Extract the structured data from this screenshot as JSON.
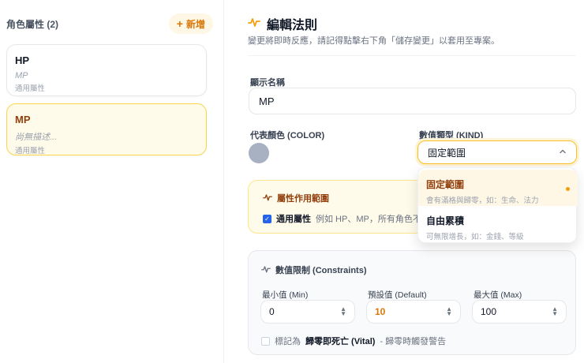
{
  "left": {
    "title": "角色屬性 (2)",
    "add_label": "新增",
    "cards": [
      {
        "name": "HP",
        "desc": "MP",
        "scope": "通用屬性"
      },
      {
        "name": "MP",
        "desc": "尚無描述...",
        "scope": "通用屬性"
      }
    ]
  },
  "editor": {
    "title": "編輯法則",
    "note": "變更將即時反應，請記得點擊右下角「儲存變更」以套用至專案。",
    "display_name_label": "顯示名稱",
    "display_name_value": "MP",
    "color_label": "代表顏色 (COLOR)",
    "color_value": "#a8b1c2",
    "kind_label": "數值類型 (KIND)",
    "kind_value": "固定範圍",
    "kind_options": [
      {
        "title": "固定範圍",
        "sub": "會有滿格與歸零，如：生命、法力"
      },
      {
        "title": "自由累積",
        "sub": "可無限增長，如：金錢、等級"
      }
    ],
    "scope": {
      "title": "屬性作用範圍",
      "checkbox_label": "通用屬性",
      "checkbox_desc": "例如 HP、MP，所有角色不論"
    },
    "constraints": {
      "title": "數值限制 (Constraints)",
      "min_label": "最小值 (Min)",
      "min_value": "0",
      "default_label": "預設值 (Default)",
      "default_value": "10",
      "max_label": "最大值 (Max)",
      "max_value": "100",
      "vital_prefix": "標記為",
      "vital_bold": "歸零即死亡 (Vital)",
      "vital_suffix": "- 歸零時觸發警告"
    }
  },
  "colors": {
    "accent": "#f59e0b",
    "selected_bg": "#fffbea"
  }
}
